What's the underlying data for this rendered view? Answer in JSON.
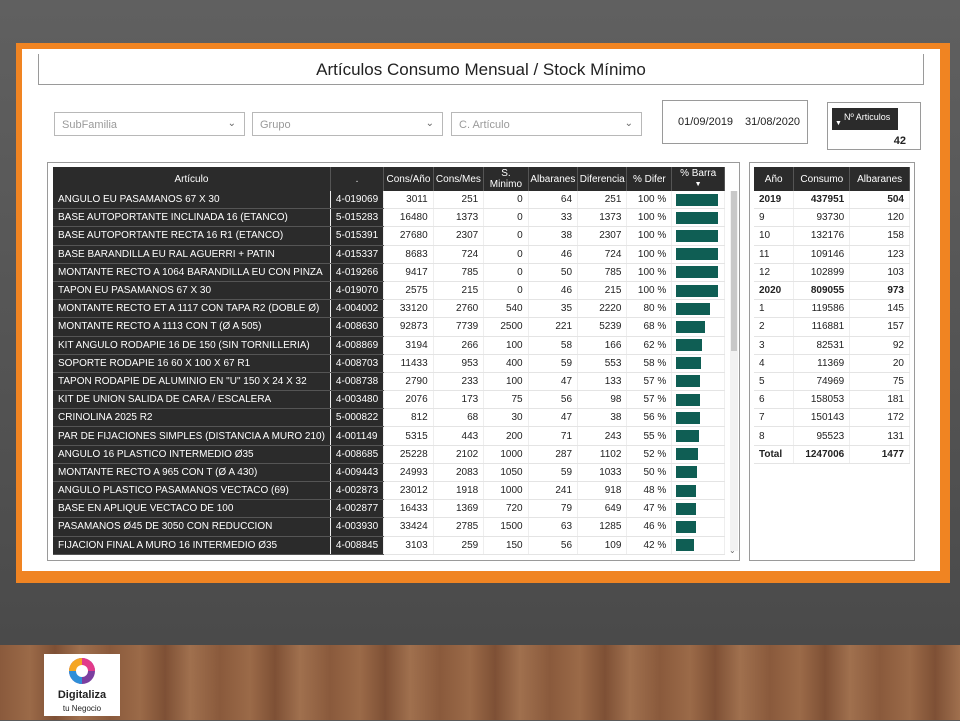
{
  "title": "Artículos Consumo Mensual / Stock Mínimo",
  "filters": {
    "subfamilia": "SubFamilia",
    "grupo": "Grupo",
    "articulo": "C. Artículo"
  },
  "date_range": {
    "from": "01/09/2019",
    "to": "31/08/2020"
  },
  "kpi": {
    "label": "Nº Articulos",
    "value": "42"
  },
  "colors": {
    "accent_frame": "#f08422",
    "bar": "#0f5e54",
    "header_bg": "#2b2b2b"
  },
  "main_table": {
    "headers": [
      "Artículo",
      ".",
      "Cons/Año",
      "Cons/Mes",
      "S. Minimo",
      "Albaranes",
      "Diferencia",
      "% Difer",
      "% Barra"
    ],
    "rows": [
      {
        "articulo": "ANGULO EU PASAMANOS 67 X 30",
        "code": "4-019069",
        "cons_ano": "3011",
        "cons_mes": "251",
        "s_min": "0",
        "albaranes": "64",
        "diferencia": "251",
        "pct": "100 %",
        "bar": 1.0
      },
      {
        "articulo": "BASE AUTOPORTANTE INCLINADA 16 (ETANCO)",
        "code": "5-015283",
        "cons_ano": "16480",
        "cons_mes": "1373",
        "s_min": "0",
        "albaranes": "33",
        "diferencia": "1373",
        "pct": "100 %",
        "bar": 1.0
      },
      {
        "articulo": "BASE AUTOPORTANTE RECTA 16 R1 (ETANCO)",
        "code": "5-015391",
        "cons_ano": "27680",
        "cons_mes": "2307",
        "s_min": "0",
        "albaranes": "38",
        "diferencia": "2307",
        "pct": "100 %",
        "bar": 1.0
      },
      {
        "articulo": "BASE BARANDILLA EU RAL AGUERRI + PATIN",
        "code": "4-015337",
        "cons_ano": "8683",
        "cons_mes": "724",
        "s_min": "0",
        "albaranes": "46",
        "diferencia": "724",
        "pct": "100 %",
        "bar": 1.0
      },
      {
        "articulo": "MONTANTE RECTO A 1064 BARANDILLA EU CON PINZA",
        "code": "4-019266",
        "cons_ano": "9417",
        "cons_mes": "785",
        "s_min": "0",
        "albaranes": "50",
        "diferencia": "785",
        "pct": "100 %",
        "bar": 1.0
      },
      {
        "articulo": "TAPON EU PASAMANOS 67 X 30",
        "code": "4-019070",
        "cons_ano": "2575",
        "cons_mes": "215",
        "s_min": "0",
        "albaranes": "46",
        "diferencia": "215",
        "pct": "100 %",
        "bar": 1.0
      },
      {
        "articulo": "MONTANTE RECTO ET A 1117 CON TAPA R2 (DOBLE Ø)",
        "code": "4-004002",
        "cons_ano": "33120",
        "cons_mes": "2760",
        "s_min": "540",
        "albaranes": "35",
        "diferencia": "2220",
        "pct": "80 %",
        "bar": 0.8
      },
      {
        "articulo": "MONTANTE RECTO A 1113 CON T (Ø A 505)",
        "code": "4-008630",
        "cons_ano": "92873",
        "cons_mes": "7739",
        "s_min": "2500",
        "albaranes": "221",
        "diferencia": "5239",
        "pct": "68 %",
        "bar": 0.68
      },
      {
        "articulo": "KIT ANGULO RODAPIE 16 DE 150 (SIN TORNILLERIA)",
        "code": "4-008869",
        "cons_ano": "3194",
        "cons_mes": "266",
        "s_min": "100",
        "albaranes": "58",
        "diferencia": "166",
        "pct": "62 %",
        "bar": 0.62
      },
      {
        "articulo": "SOPORTE RODAPIE 16 60 X 100 X 67 R1",
        "code": "4-008703",
        "cons_ano": "11433",
        "cons_mes": "953",
        "s_min": "400",
        "albaranes": "59",
        "diferencia": "553",
        "pct": "58 %",
        "bar": 0.58
      },
      {
        "articulo": "TAPON RODAPIE DE ALUMINIO EN \"U\" 150 X 24 X 32",
        "code": "4-008738",
        "cons_ano": "2790",
        "cons_mes": "233",
        "s_min": "100",
        "albaranes": "47",
        "diferencia": "133",
        "pct": "57 %",
        "bar": 0.57
      },
      {
        "articulo": "KIT DE UNION SALIDA DE CARA  / ESCALERA",
        "code": "4-003480",
        "cons_ano": "2076",
        "cons_mes": "173",
        "s_min": "75",
        "albaranes": "56",
        "diferencia": "98",
        "pct": "57 %",
        "bar": 0.57
      },
      {
        "articulo": "CRINOLINA 2025 R2",
        "code": "5-000822",
        "cons_ano": "812",
        "cons_mes": "68",
        "s_min": "30",
        "albaranes": "47",
        "diferencia": "38",
        "pct": "56 %",
        "bar": 0.56
      },
      {
        "articulo": "PAR DE FIJACIONES SIMPLES (DISTANCIA A MURO 210)",
        "code": "4-001149",
        "cons_ano": "5315",
        "cons_mes": "443",
        "s_min": "200",
        "albaranes": "71",
        "diferencia": "243",
        "pct": "55 %",
        "bar": 0.55
      },
      {
        "articulo": "ANGULO 16 PLASTICO INTERMEDIO Ø35",
        "code": "4-008685",
        "cons_ano": "25228",
        "cons_mes": "2102",
        "s_min": "1000",
        "albaranes": "287",
        "diferencia": "1102",
        "pct": "52 %",
        "bar": 0.52
      },
      {
        "articulo": "MONTANTE RECTO A 965 CON T (Ø A 430)",
        "code": "4-009443",
        "cons_ano": "24993",
        "cons_mes": "2083",
        "s_min": "1050",
        "albaranes": "59",
        "diferencia": "1033",
        "pct": "50 %",
        "bar": 0.5
      },
      {
        "articulo": "ANGULO PLASTICO PASAMANOS VECTACO (69)",
        "code": "4-002873",
        "cons_ano": "23012",
        "cons_mes": "1918",
        "s_min": "1000",
        "albaranes": "241",
        "diferencia": "918",
        "pct": "48 %",
        "bar": 0.48
      },
      {
        "articulo": "BASE EN APLIQUE VECTACO DE 100",
        "code": "4-002877",
        "cons_ano": "16433",
        "cons_mes": "1369",
        "s_min": "720",
        "albaranes": "79",
        "diferencia": "649",
        "pct": "47 %",
        "bar": 0.47
      },
      {
        "articulo": "PASAMANOS Ø45 DE 3050 CON REDUCCION",
        "code": "4-003930",
        "cons_ano": "33424",
        "cons_mes": "2785",
        "s_min": "1500",
        "albaranes": "63",
        "diferencia": "1285",
        "pct": "46 %",
        "bar": 0.46
      },
      {
        "articulo": "FIJACION FINAL A MURO 16 INTERMEDIO Ø35",
        "code": "4-008845",
        "cons_ano": "3103",
        "cons_mes": "259",
        "s_min": "150",
        "albaranes": "56",
        "diferencia": "109",
        "pct": "42 %",
        "bar": 0.42
      }
    ]
  },
  "side_table": {
    "headers": [
      "Año",
      "Consumo",
      "Albaranes"
    ],
    "rows": [
      {
        "k": "2019",
        "consumo": "437951",
        "albaranes": "504",
        "bold": true
      },
      {
        "k": "9",
        "consumo": "93730",
        "albaranes": "120",
        "bold": false
      },
      {
        "k": "10",
        "consumo": "132176",
        "albaranes": "158",
        "bold": false
      },
      {
        "k": "11",
        "consumo": "109146",
        "albaranes": "123",
        "bold": false
      },
      {
        "k": "12",
        "consumo": "102899",
        "albaranes": "103",
        "bold": false
      },
      {
        "k": "2020",
        "consumo": "809055",
        "albaranes": "973",
        "bold": true
      },
      {
        "k": "1",
        "consumo": "119586",
        "albaranes": "145",
        "bold": false
      },
      {
        "k": "2",
        "consumo": "116881",
        "albaranes": "157",
        "bold": false
      },
      {
        "k": "3",
        "consumo": "82531",
        "albaranes": "92",
        "bold": false
      },
      {
        "k": "4",
        "consumo": "11369",
        "albaranes": "20",
        "bold": false
      },
      {
        "k": "5",
        "consumo": "74969",
        "albaranes": "75",
        "bold": false
      },
      {
        "k": "6",
        "consumo": "158053",
        "albaranes": "181",
        "bold": false
      },
      {
        "k": "7",
        "consumo": "150143",
        "albaranes": "172",
        "bold": false
      },
      {
        "k": "8",
        "consumo": "95523",
        "albaranes": "131",
        "bold": false
      },
      {
        "k": "Total",
        "consumo": "1247006",
        "albaranes": "1477",
        "bold": true
      }
    ]
  },
  "logo": {
    "line1": "Digitaliza",
    "line2": "tu Negocio"
  }
}
